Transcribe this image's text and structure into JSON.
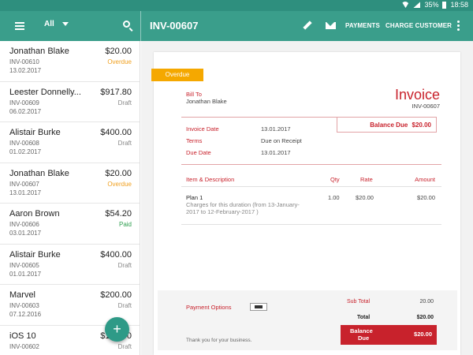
{
  "status_bar": {
    "battery": "35%",
    "time": "18:58"
  },
  "app_bar": {
    "filter_label": "All",
    "invoice_title": "INV-00607",
    "payments_label": "PAYMENTS",
    "charge_label": "CHARGE CUSTOMER"
  },
  "invoices": [
    {
      "name": "Jonathan  Blake",
      "amount": "$20.00",
      "number": "INV-00610",
      "status": "Overdue",
      "date": "13.02.2017"
    },
    {
      "name": "Leester Donnelly...",
      "amount": "$917.80",
      "number": "INV-00609",
      "status": "Draft",
      "date": "06.02.2017"
    },
    {
      "name": "Alistair Burke",
      "amount": "$400.00",
      "number": "INV-00608",
      "status": "Draft",
      "date": "01.02.2017"
    },
    {
      "name": "Jonathan  Blake",
      "amount": "$20.00",
      "number": "INV-00607",
      "status": "Overdue",
      "date": "13.01.2017"
    },
    {
      "name": "Aaron Brown",
      "amount": "$54.20",
      "number": "INV-00606",
      "status": "Paid",
      "date": "03.01.2017"
    },
    {
      "name": "Alistair Burke",
      "amount": "$400.00",
      "number": "INV-00605",
      "status": "Draft",
      "date": "01.01.2017"
    },
    {
      "name": "Marvel",
      "amount": "$200.00",
      "number": "INV-00603",
      "status": "Draft",
      "date": "07.12.2016"
    },
    {
      "name": "iOS 10",
      "amount": "$150.00",
      "number": "INV-00602",
      "status": "Draft",
      "date": ""
    }
  ],
  "fab_label": "+",
  "invoice": {
    "status_ribbon": "Overdue",
    "bill_to_label": "Bill To",
    "bill_to_name": "Jonathan Blake",
    "heading": "Invoice",
    "number": "INV-00607",
    "balance_due_label": "Balance Due",
    "balance_due_value": "$20.00",
    "invoice_date_label": "Invoice Date",
    "invoice_date": "13.01.2017",
    "terms_label": "Terms",
    "terms": "Due on Receipt",
    "due_date_label": "Due Date",
    "due_date": "13.01.2017",
    "columns": {
      "item": "Item & Description",
      "qty": "Qty",
      "rate": "Rate",
      "amount": "Amount"
    },
    "items": [
      {
        "name": "Plan 1",
        "desc_line1": "Charges for this duration (from 13-January-",
        "desc_line2": "2017 to 12-February-2017 )",
        "qty": "1.00",
        "rate": "$20.00",
        "amount": "$20.00"
      }
    ],
    "payment_options_label": "Payment Options",
    "sub_total_label": "Sub Total",
    "sub_total": "20.00",
    "total_label": "Total",
    "total": "$20.00",
    "footer_balance_line1": "Balance",
    "footer_balance_line2": "Due",
    "footer_balance_value": "$20.00",
    "thanks": "Thank you for your business."
  }
}
